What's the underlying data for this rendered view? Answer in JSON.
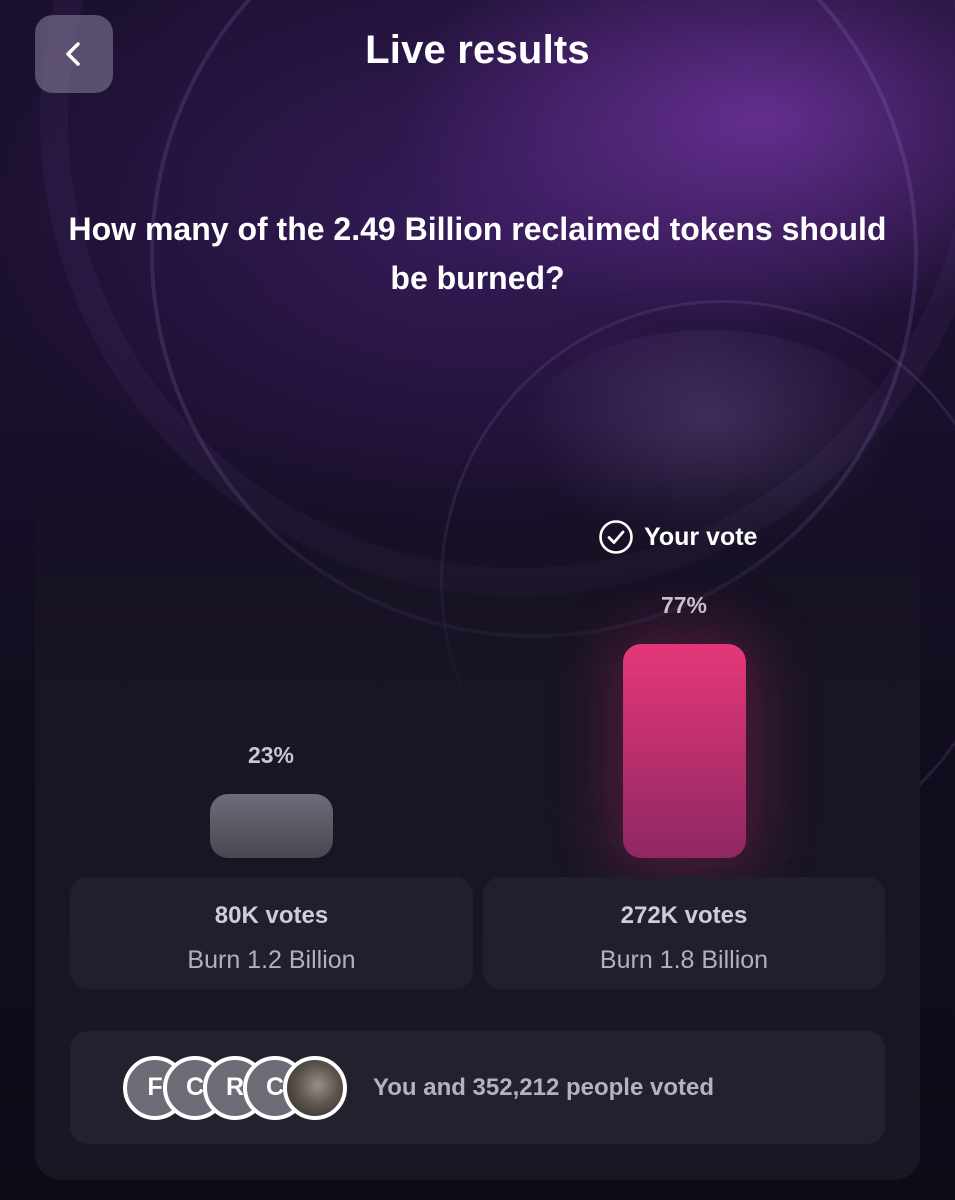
{
  "header": {
    "title": "Live results",
    "back_icon": "chevron-left-icon"
  },
  "question": "How many of the 2.49 Billion reclaimed tokens should be burned?",
  "your_vote_label": "Your vote",
  "options": [
    {
      "percent_label": "23%",
      "percent": 23,
      "votes": "80K votes",
      "label": "Burn 1.2 Billion",
      "color": "#6f6c79"
    },
    {
      "percent_label": "77%",
      "percent": 77,
      "votes": "272K votes",
      "label": "Burn 1.8 Billion",
      "color": "#e63778",
      "selected": true
    }
  ],
  "voters": {
    "avatars": [
      "F",
      "C",
      "R",
      "C",
      ""
    ],
    "text": "You and 352,212 people voted"
  }
}
